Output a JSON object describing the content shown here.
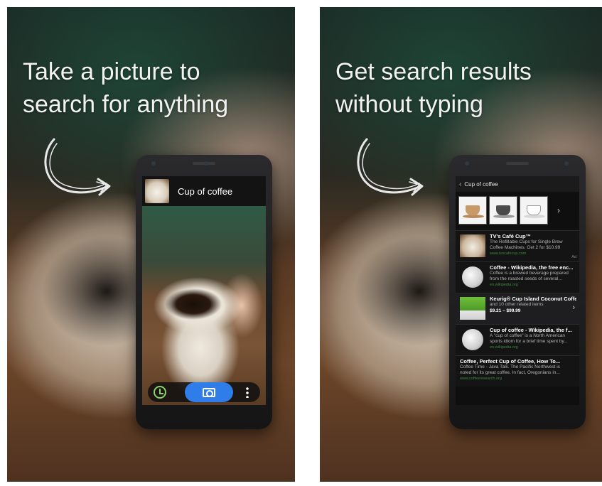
{
  "colors": {
    "headline_text": "#f2f2f2",
    "camera_button": "#2f7de8",
    "history_icon": "#8bd26a",
    "result_url": "#3d8a3d"
  },
  "left_panel": {
    "headline_line1": "Take a picture to",
    "headline_line2": "search for anything",
    "phone": {
      "result_title": "Cup of coffee",
      "toolbar": {
        "history_icon": "history-clock-icon",
        "camera_icon": "camera-icon",
        "more_icon": "more-vertical-icon"
      }
    }
  },
  "right_panel": {
    "headline_line1": "Get search results",
    "headline_line2": "without typing",
    "phone": {
      "back_glyph": "‹",
      "header_title": "Cup of coffee",
      "strip_more": "›",
      "results": [
        {
          "title": "TV's Café Cup™",
          "line1": "The Refillable Cups for Single Brew",
          "line2": "Coffee Machines. Get 2 for $10.99",
          "url": "www.tvscafecup.com",
          "ad": "Ad"
        },
        {
          "title": "Coffee - Wikipedia, the free enc...",
          "line1": "Coffee is a brewed beverage prepared",
          "line2": "from the roasted seeds of several...",
          "url": "en.wikipedia.org"
        },
        {
          "title": "Keurig® Cup Island Coconut Coffe...",
          "line1": "and 10 other related items",
          "price": "$9.21 – $99.99",
          "chevron": "›"
        },
        {
          "title": "Cup of coffee - Wikipedia, the f...",
          "line1": "A \"cup of coffee\" is a North American",
          "line2": "sports idiom for a brief time spent by...",
          "url": "en.wikipedia.org"
        },
        {
          "title": "Coffee, Perfect Cup of Coffee, How To...",
          "line1": "Coffee Time - Java Talk. The Pacific Northwest is",
          "line2": "noted for its great coffee. In fact, Oregonians in...",
          "url": "www.coffeeresearch.org"
        }
      ]
    }
  }
}
